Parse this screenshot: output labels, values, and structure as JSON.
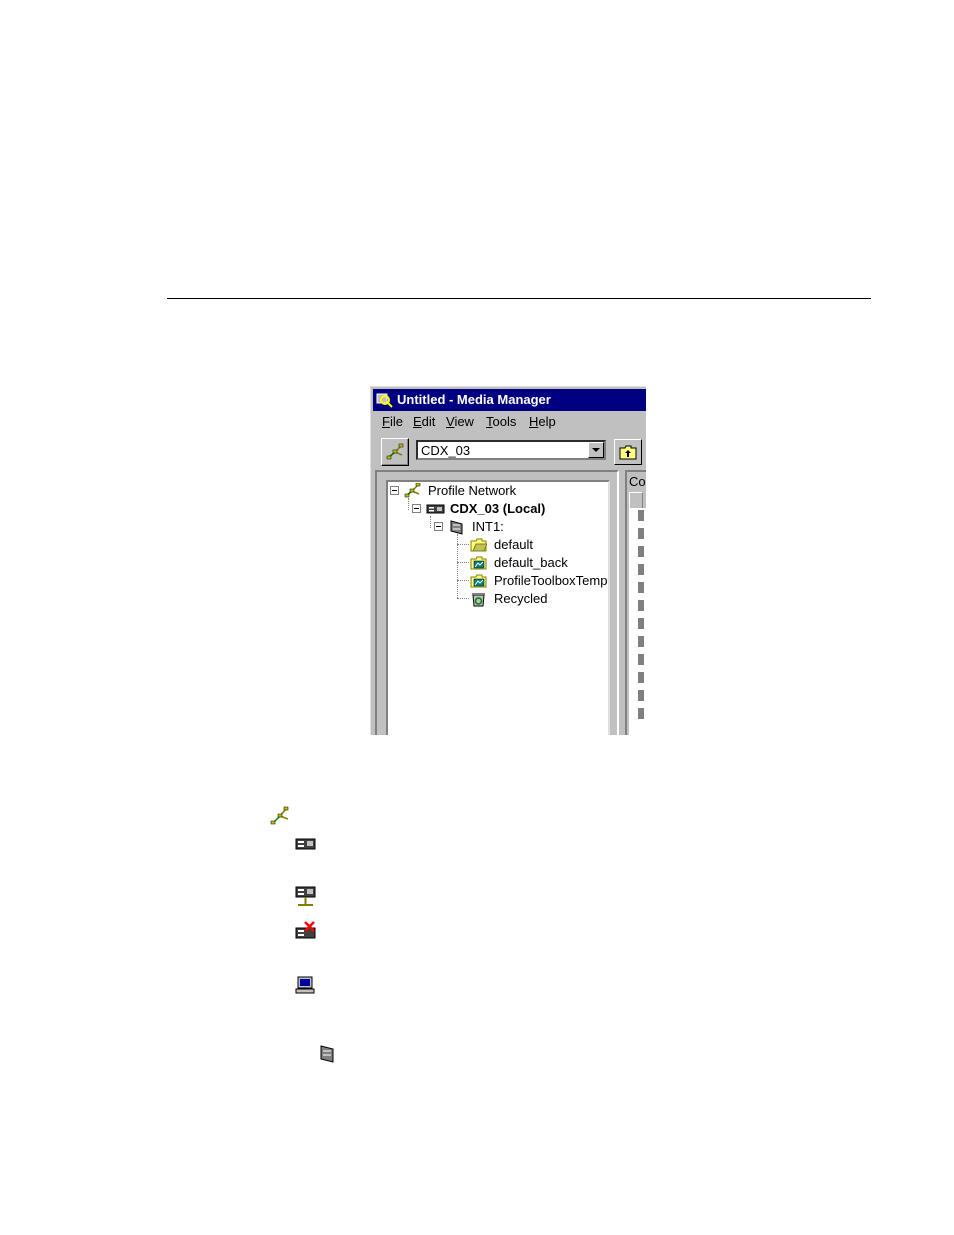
{
  "window": {
    "title": "Untitled - Media Manager",
    "menu": [
      {
        "label": "File",
        "ul": "F",
        "rest": "ile"
      },
      {
        "label": "Edit",
        "ul": "E",
        "rest": "dit"
      },
      {
        "label": "View",
        "ul": "V",
        "rest": "iew"
      },
      {
        "label": "Tools",
        "ul": "T",
        "rest": "ools"
      },
      {
        "label": "Help",
        "ul": "H",
        "rest": "elp"
      }
    ],
    "toolbar": {
      "machine_value": "CDX_03"
    },
    "tree": {
      "root": "Profile Network",
      "machine": "CDX_03 (Local)",
      "volume": "INT1:",
      "bins": [
        "default",
        "default_back",
        "ProfileToolboxTemp",
        "Recycled"
      ]
    },
    "right_pane": {
      "column_header": "Co"
    }
  },
  "icons": {
    "app": "media-manager-icon",
    "network": "network-icon",
    "machine": "machine-icon",
    "volume": "volume-icon",
    "folder": "folder-icon",
    "recycle": "recycle-bin-icon",
    "up": "up-folder-icon"
  },
  "colors": {
    "title_bar": "#000080",
    "window_face": "#c0c0c0"
  }
}
